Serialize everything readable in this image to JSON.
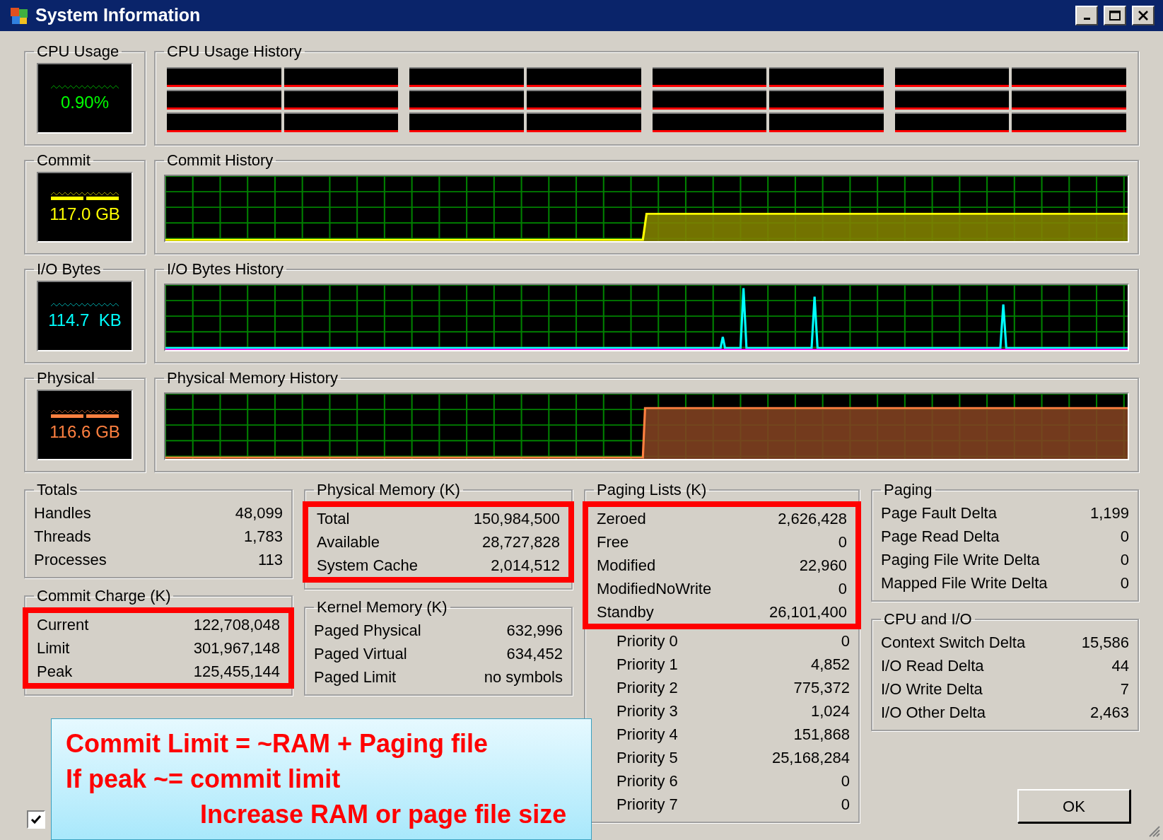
{
  "window": {
    "title": "System Information"
  },
  "meters": [
    {
      "kind": "cpu",
      "title": "CPU Usage",
      "reading": "0.90%",
      "color": "#00ff00",
      "history_title": "CPU Usage History"
    },
    {
      "kind": "commit",
      "title": "Commit",
      "reading": "117.0 GB",
      "color": "#ffff00",
      "history_title": "Commit History"
    },
    {
      "kind": "io",
      "title": "I/O Bytes",
      "reading": "114.7  KB",
      "color": "#00ffff",
      "history_title": "I/O Bytes History"
    },
    {
      "kind": "physical",
      "title": "Physical",
      "reading": "116.6 GB",
      "color": "#ff8040",
      "history_title": "Physical Memory History"
    }
  ],
  "columns": [
    [
      {
        "title": "Totals",
        "highlighted": false,
        "rows": [
          {
            "label": "Handles",
            "value": "48,099"
          },
          {
            "label": "Threads",
            "value": "1,783"
          },
          {
            "label": "Processes",
            "value": "113"
          }
        ]
      },
      {
        "title": "Commit Charge (K)",
        "highlighted": true,
        "rows": [
          {
            "label": "Current",
            "value": "122,708,048"
          },
          {
            "label": "Limit",
            "value": "301,967,148"
          },
          {
            "label": "Peak",
            "value": "125,455,144"
          }
        ]
      }
    ],
    [
      {
        "title": "Physical Memory (K)",
        "highlighted": true,
        "rows": [
          {
            "label": "Total",
            "value": "150,984,500"
          },
          {
            "label": "Available",
            "value": "28,727,828"
          },
          {
            "label": "System Cache",
            "value": "2,014,512"
          }
        ]
      },
      {
        "title": "Kernel Memory (K)",
        "highlighted": false,
        "rows": [
          {
            "label": "Paged Physical",
            "value": "632,996"
          },
          {
            "label": "Paged Virtual",
            "value": "634,452"
          },
          {
            "label": "Paged Limit",
            "value": "no symbols"
          }
        ]
      }
    ],
    [
      {
        "title": "Paging Lists (K)",
        "highlighted": true,
        "rows": [
          {
            "label": "Zeroed",
            "value": "2,626,428"
          },
          {
            "label": "Free",
            "value": "0"
          },
          {
            "label": "Modified",
            "value": "22,960"
          },
          {
            "label": "ModifiedNoWrite",
            "value": "0"
          },
          {
            "label": "Standby",
            "value": "26,101,400",
            "children": [
              {
                "label": "Priority 0",
                "value": "0"
              },
              {
                "label": "Priority 1",
                "value": "4,852"
              },
              {
                "label": "Priority 2",
                "value": "775,372"
              },
              {
                "label": "Priority 3",
                "value": "1,024"
              },
              {
                "label": "Priority 4",
                "value": "151,868"
              },
              {
                "label": "Priority 5",
                "value": "25,168,284"
              },
              {
                "label": "Priority 6",
                "value": "0"
              },
              {
                "label": "Priority 7",
                "value": "0"
              }
            ]
          }
        ]
      }
    ],
    [
      {
        "title": "Paging",
        "highlighted": false,
        "rows": [
          {
            "label": "Page Fault Delta",
            "value": "1,199"
          },
          {
            "label": "Page Read Delta",
            "value": "0"
          },
          {
            "label": "Paging File Write Delta",
            "value": "0"
          },
          {
            "label": "Mapped File Write Delta",
            "value": "0"
          }
        ]
      },
      {
        "title": "CPU and I/O",
        "highlighted": false,
        "rows": [
          {
            "label": "Context Switch Delta",
            "value": "15,586"
          },
          {
            "label": "I/O Read Delta",
            "value": "44"
          },
          {
            "label": "I/O Write Delta",
            "value": "7"
          },
          {
            "label": "I/O Other Delta",
            "value": "2,463"
          }
        ]
      }
    ]
  ],
  "checkbox": {
    "checked": true
  },
  "ok_button": "OK",
  "callout": {
    "lines": [
      {
        "text": "Commit Limit = ~RAM + Paging file",
        "kind": "plain"
      },
      {
        "text": "If peak ~= commit limit",
        "kind": "plain"
      },
      {
        "text": "Increase RAM or page file size",
        "kind": "indented"
      }
    ]
  }
}
